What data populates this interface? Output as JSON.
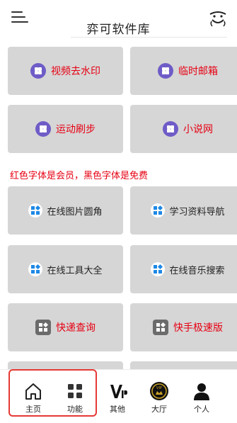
{
  "header": {
    "title": "弈可软件库"
  },
  "cards": [
    {
      "label": "视频去水印",
      "tier": "member",
      "icon": "purple-grid-circle-icon"
    },
    {
      "label": "临时邮箱",
      "tier": "member",
      "icon": "purple-grid-circle-icon"
    },
    {
      "label": "运动刷步",
      "tier": "member",
      "icon": "purple-grid-circle-icon"
    },
    {
      "label": "小说网",
      "tier": "member",
      "icon": "purple-grid-circle-icon"
    },
    {
      "label": "在线图片圆角",
      "tier": "free",
      "icon": "blue-app-grid-icon"
    },
    {
      "label": "学习资料导航",
      "tier": "free",
      "icon": "blue-app-grid-icon"
    },
    {
      "label": "在线工具大全",
      "tier": "free",
      "icon": "blue-app-grid-icon"
    },
    {
      "label": "在线音乐搜索",
      "tier": "free",
      "icon": "blue-app-grid-icon"
    },
    {
      "label": "快递查询",
      "tier": "member",
      "icon": "gray-app-grid-icon"
    },
    {
      "label": "快手极速版",
      "tier": "member",
      "icon": "gray-app-grid-icon"
    }
  ],
  "notice": "红色字体是会员，黑色字体是免费",
  "tabbar": [
    {
      "label": "主页",
      "icon": "home-icon"
    },
    {
      "label": "功能",
      "icon": "grid-icon"
    },
    {
      "label": "其他",
      "icon": "vip-icon"
    },
    {
      "label": "大厅",
      "icon": "vip-badge-icon"
    },
    {
      "label": "个人",
      "icon": "person-icon"
    }
  ],
  "colors": {
    "member_text": "#e60012",
    "free_text": "#222222",
    "card_bg": "#d6d6d6",
    "highlight": "#e53935"
  }
}
